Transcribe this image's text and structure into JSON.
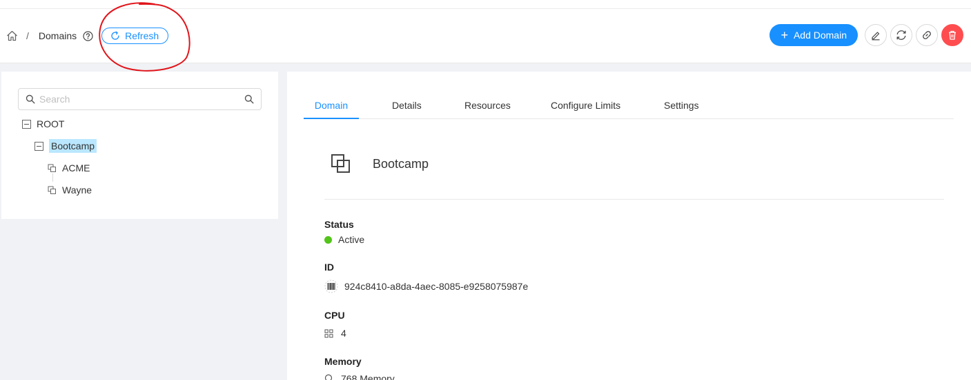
{
  "header": {
    "breadcrumb": {
      "current": "Domains",
      "separator": "/"
    },
    "refresh_label": "Refresh",
    "add_domain_label": "Add Domain"
  },
  "tree": {
    "search_placeholder": "Search",
    "nodes": [
      {
        "label": "ROOT",
        "expanded": true
      },
      {
        "label": "Bootcamp",
        "expanded": true,
        "selected": true
      },
      {
        "label": "ACME"
      },
      {
        "label": "Wayne"
      }
    ]
  },
  "tabs": [
    {
      "label": "Domain",
      "active": true
    },
    {
      "label": "Details"
    },
    {
      "label": "Resources"
    },
    {
      "label": "Configure Limits"
    },
    {
      "label": "Settings"
    }
  ],
  "detail": {
    "name": "Bootcamp",
    "fields": [
      {
        "label": "Status",
        "value": "Active"
      },
      {
        "label": "ID",
        "value": "924c8410-a8da-4aec-8085-e9258075987e"
      },
      {
        "label": "CPU",
        "value": "4"
      },
      {
        "label": "Memory",
        "value": "768 Memory"
      }
    ]
  },
  "colors": {
    "primary": "#1890ff",
    "danger": "#ff4d4f",
    "success": "#52c41a",
    "annotation": "#e0151b"
  }
}
